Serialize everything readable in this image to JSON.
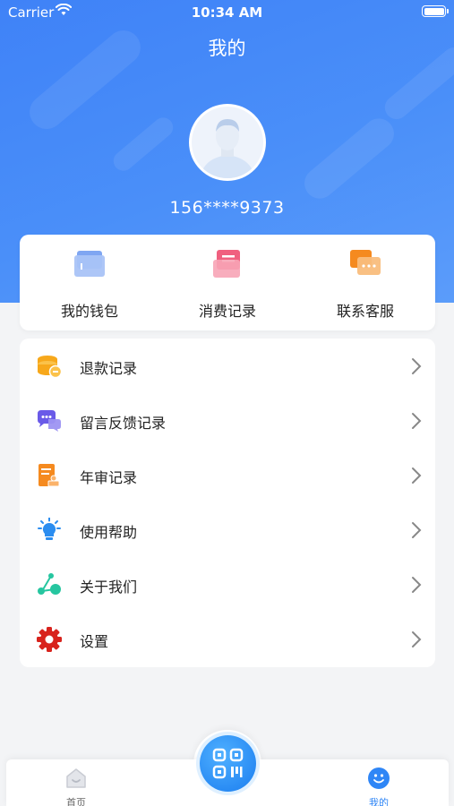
{
  "status_bar": {
    "carrier": "Carrier",
    "time": "10:34 AM"
  },
  "header": {
    "title": "我的",
    "phone": "156****9373",
    "background_color": "#4a8ff9"
  },
  "quick_actions": [
    {
      "label": "我的钱包",
      "icon": "wallet-icon"
    },
    {
      "label": "消费记录",
      "icon": "receipt-icon"
    },
    {
      "label": "联系客服",
      "icon": "chat-bubbles-icon"
    }
  ],
  "menu": [
    {
      "label": "退款记录",
      "icon": "coin-stack-icon"
    },
    {
      "label": "留言反馈记录",
      "icon": "message-bubbles-icon"
    },
    {
      "label": "年审记录",
      "icon": "document-stamp-icon"
    },
    {
      "label": "使用帮助",
      "icon": "lightbulb-icon"
    },
    {
      "label": "关于我们",
      "icon": "network-nodes-icon"
    },
    {
      "label": "设置",
      "icon": "gear-icon"
    }
  ],
  "tabbar": {
    "home_label": "首页",
    "mine_label": "我的",
    "active_color": "#2f86f6",
    "inactive_color": "#666666",
    "center_icon": "qr-scan-icon"
  }
}
